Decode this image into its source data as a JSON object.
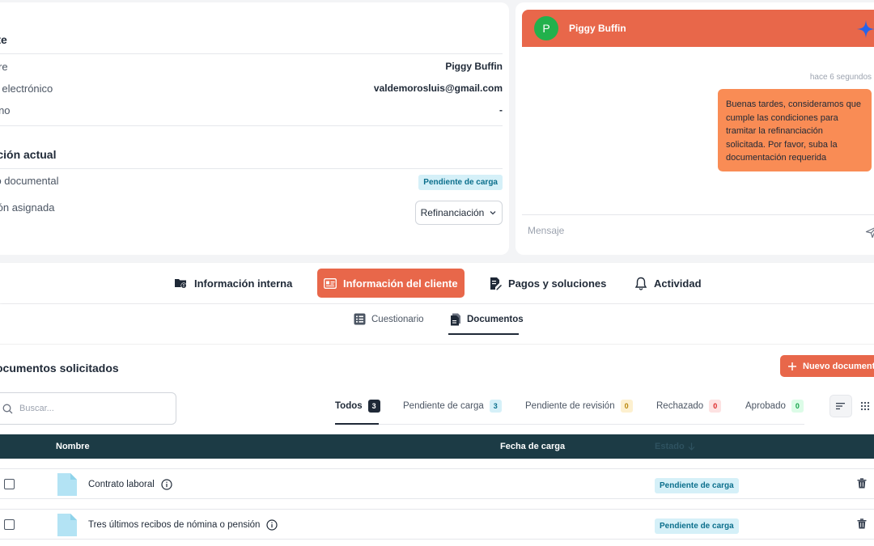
{
  "client": {
    "section_title": "ente",
    "rows": [
      {
        "label": "mbre",
        "value": "Piggy Buffin"
      },
      {
        "label": "reo electrónico",
        "value": "valdemorosluis@gmail.com"
      },
      {
        "label": "éfono",
        "value": "-"
      }
    ]
  },
  "situation": {
    "section_title": "uación actual",
    "doc_state_label": "ado documental",
    "doc_state_badge": "Pendiente de carga",
    "solution_label": "ución asignada",
    "solution_value": "Refinanciación"
  },
  "chat": {
    "avatar_letter": "P",
    "name": "Piggy Buffin",
    "timestamp": "hace 6 segundos",
    "message": "Buenas tardes, consideramos que cumple las condiciones para tramitar la refinanciación solicitada. Por favor, suba la documentación requerida",
    "input_placeholder": "Mensaje",
    "header_color": "#e8674a",
    "bubble_color": "#f98c55"
  },
  "main_tabs": [
    {
      "label": "Información interna",
      "icon": "folder-alert-icon"
    },
    {
      "label": "Información del cliente",
      "icon": "id-card-icon",
      "active": true
    },
    {
      "label": "Pagos y soluciones",
      "icon": "document-edit-icon"
    },
    {
      "label": "Actividad",
      "icon": "bell-icon"
    }
  ],
  "sub_tabs": [
    {
      "label": "Cuestionario",
      "icon": "list-icon"
    },
    {
      "label": "Documentos",
      "icon": "documents-icon",
      "active": true
    }
  ],
  "documents": {
    "title": "ocumentos solicitados",
    "new_button": "Nuevo documento",
    "search_placeholder": "Buscar...",
    "filters": [
      {
        "label": "Todos",
        "count": "3"
      },
      {
        "label": "Pendiente de carga",
        "count": "3"
      },
      {
        "label": "Pendiente de revisión",
        "count": "0"
      },
      {
        "label": "Rechazado",
        "count": "0"
      },
      {
        "label": "Aprobado",
        "count": "0"
      }
    ],
    "columns": {
      "name": "Nombre",
      "date": "Fecha de carga",
      "status": "Estado"
    },
    "rows": [
      {
        "name": "Contrato laboral",
        "date": "",
        "status": "Pendiente de carga"
      },
      {
        "name": "Tres últimos recibos de nómina o pensión",
        "date": "",
        "status": "Pendiente de carga"
      }
    ]
  }
}
